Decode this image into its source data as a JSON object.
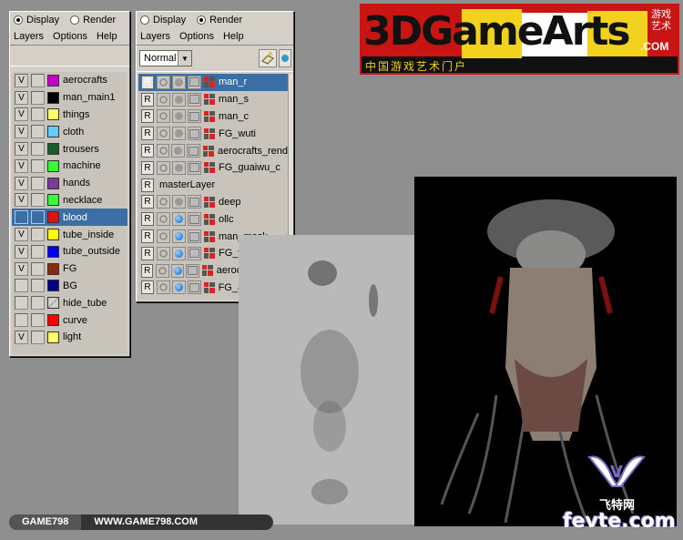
{
  "left_panel": {
    "display_label": "Display",
    "render_label": "Render",
    "menu": [
      "Layers",
      "Options",
      "Help"
    ],
    "layers": [
      {
        "v": "V",
        "color": "#c800c8",
        "name": "aerocrafts",
        "selected": false
      },
      {
        "v": "V",
        "color": "#000000",
        "name": "man_main1",
        "selected": false
      },
      {
        "v": "V",
        "color": "#ffff66",
        "name": "things",
        "selected": false
      },
      {
        "v": "V",
        "color": "#66ccff",
        "name": "cloth",
        "selected": false
      },
      {
        "v": "V",
        "color": "#1a5c2a",
        "name": "trousers",
        "selected": false
      },
      {
        "v": "V",
        "color": "#33ff33",
        "name": "machine",
        "selected": false
      },
      {
        "v": "V",
        "color": "#7a3a9a",
        "name": "hands",
        "selected": false
      },
      {
        "v": "V",
        "color": "#33ff33",
        "name": "necklace",
        "selected": false
      },
      {
        "v": "",
        "color": "#e01010",
        "name": "blood",
        "selected": true
      },
      {
        "v": "V",
        "color": "#ffff00",
        "name": "tube_inside",
        "selected": false
      },
      {
        "v": "V",
        "color": "#0000ff",
        "name": "tube_outside",
        "selected": false
      },
      {
        "v": "V",
        "color": "#8a2a10",
        "name": "FG",
        "selected": false
      },
      {
        "v": "",
        "color": "#000088",
        "name": "BG",
        "selected": false
      },
      {
        "v": "",
        "color": "none",
        "name": "hide_tube",
        "selected": false
      },
      {
        "v": "",
        "color": "#ff0000",
        "name": "curve",
        "selected": false
      },
      {
        "v": "V",
        "color": "#ffff66",
        "name": "light",
        "selected": false
      }
    ]
  },
  "right_panel": {
    "display_label": "Display",
    "render_label": "Render",
    "menu": [
      "Layers",
      "Options",
      "Help"
    ],
    "blend_mode": "Normal",
    "layers": [
      {
        "r": "R",
        "name": "man_r",
        "blue": false,
        "selected": true
      },
      {
        "r": "R",
        "name": "man_s",
        "blue": false,
        "selected": false
      },
      {
        "r": "R",
        "name": "man_c",
        "blue": false,
        "selected": false
      },
      {
        "r": "R",
        "name": "FG_wuti",
        "blue": false,
        "selected": false
      },
      {
        "r": "R",
        "name": "aerocrafts_rend",
        "blue": false,
        "selected": false
      },
      {
        "r": "R",
        "name": "FG_guaiwu_c",
        "blue": false,
        "selected": false
      },
      {
        "r": "R",
        "name": "masterLayer",
        "master": true
      },
      {
        "r": "R",
        "name": "deep",
        "blue": false,
        "selected": false
      },
      {
        "r": "R",
        "name": "ollc",
        "blue": true,
        "selected": false
      },
      {
        "r": "R",
        "name": "man_mask",
        "blue": true,
        "selected": false
      },
      {
        "r": "R",
        "name": "FG_wuti_mask",
        "blue": true,
        "selected": false
      },
      {
        "r": "R",
        "name": "aerocrafts_masl",
        "blue": true,
        "selected": false
      },
      {
        "r": "R",
        "name": "FG_aerocrafts_",
        "blue": true,
        "selected": false
      }
    ]
  },
  "logo": {
    "main": "3DGameArts",
    "suffix": ".COM",
    "subtitle": "中国游戏艺术门户",
    "side": "游戏艺术"
  },
  "footer": {
    "left": "GAME798",
    "right": "WWW.GAME798.COM"
  },
  "watermark": {
    "text": "飞特网",
    "url": "fevte.com"
  }
}
